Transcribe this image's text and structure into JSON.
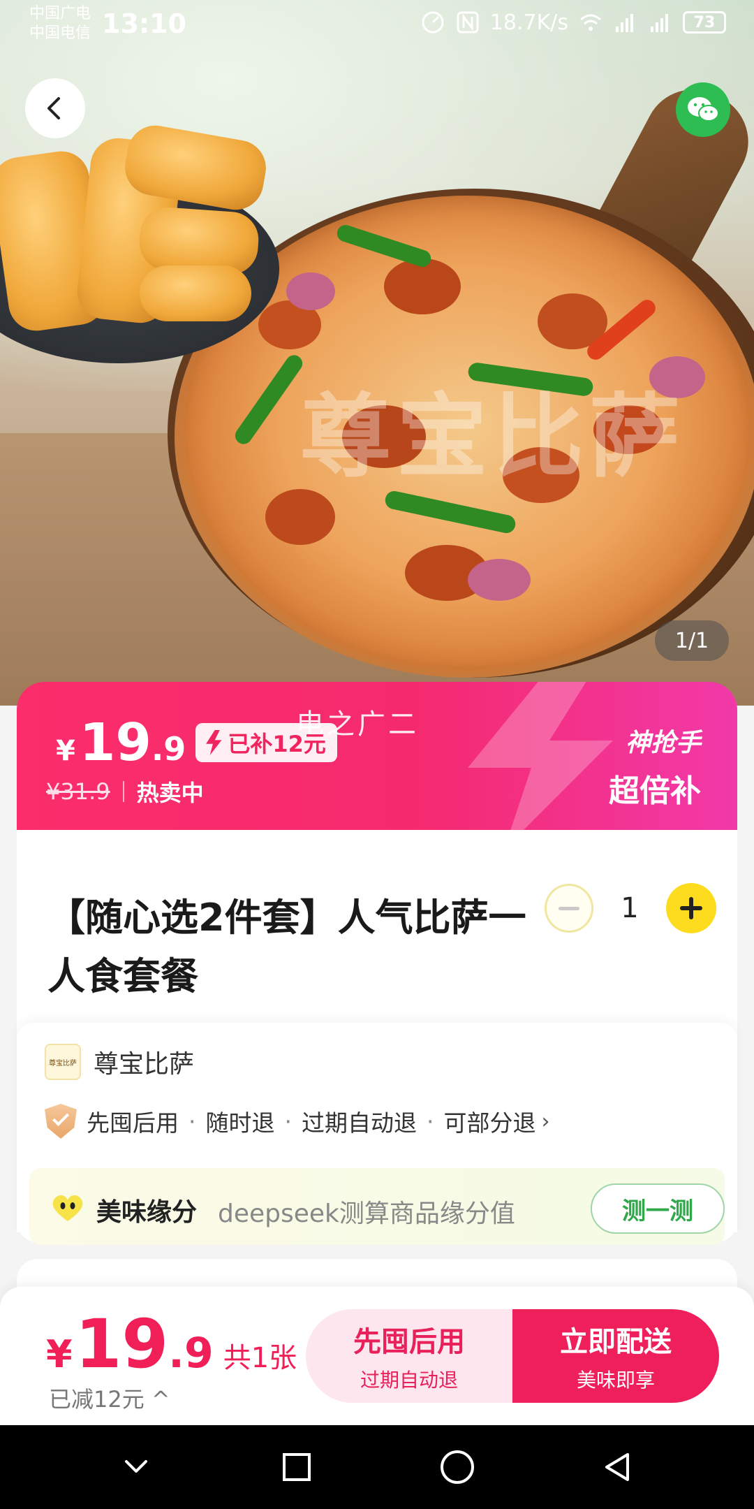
{
  "status_bar": {
    "carrier1": "中国广电",
    "carrier2": "中国电信",
    "time": "13:10",
    "net_speed": "18.7K/s",
    "signal1": "4G",
    "signal2": "4G",
    "battery": "73"
  },
  "hero": {
    "watermark": "尊宝比萨",
    "page_indicator": "1/1"
  },
  "promo": {
    "currency": "¥",
    "price_int": "19",
    "price_dec": ".9",
    "subsidy_label": "已补12元",
    "original_price": "¥31.9",
    "status": "热卖中",
    "overlay_text": "电之广二",
    "badge_line1": "神抢手",
    "badge_line2": "超倍补"
  },
  "product": {
    "title": "【随心选2件套】人气比萨一人食套餐",
    "quantity": "1"
  },
  "store": {
    "logo_text": "尊宝比萨",
    "name": "尊宝比萨",
    "policies": [
      "先囤后用",
      "随时退",
      "过期自动退",
      "可部分退"
    ],
    "chevron": "›"
  },
  "fate": {
    "title": "美味缘分",
    "description": "deepseek测算商品缘分值",
    "button": "测一测"
  },
  "bottom_bar": {
    "currency": "¥",
    "price_int": "19",
    "price_dec": ".9",
    "count": "共1张",
    "reduced": "已减12元 ^",
    "left_action_main": "先囤后用",
    "left_action_sub": "过期自动退",
    "right_action_main": "立即配送",
    "right_action_sub": "美味即享"
  },
  "colors": {
    "brand_pink": "#f01f58",
    "promo_gradient_end": "#f139a9",
    "qty_plus_yellow": "#fddb1f",
    "fate_button_green": "#2fa84a",
    "wechat_green": "#2dbd52"
  },
  "icons": {
    "back": "chevron-left-icon",
    "share": "wechat-icon",
    "policy": "shield-check-icon",
    "fate": "heart-face-icon"
  }
}
